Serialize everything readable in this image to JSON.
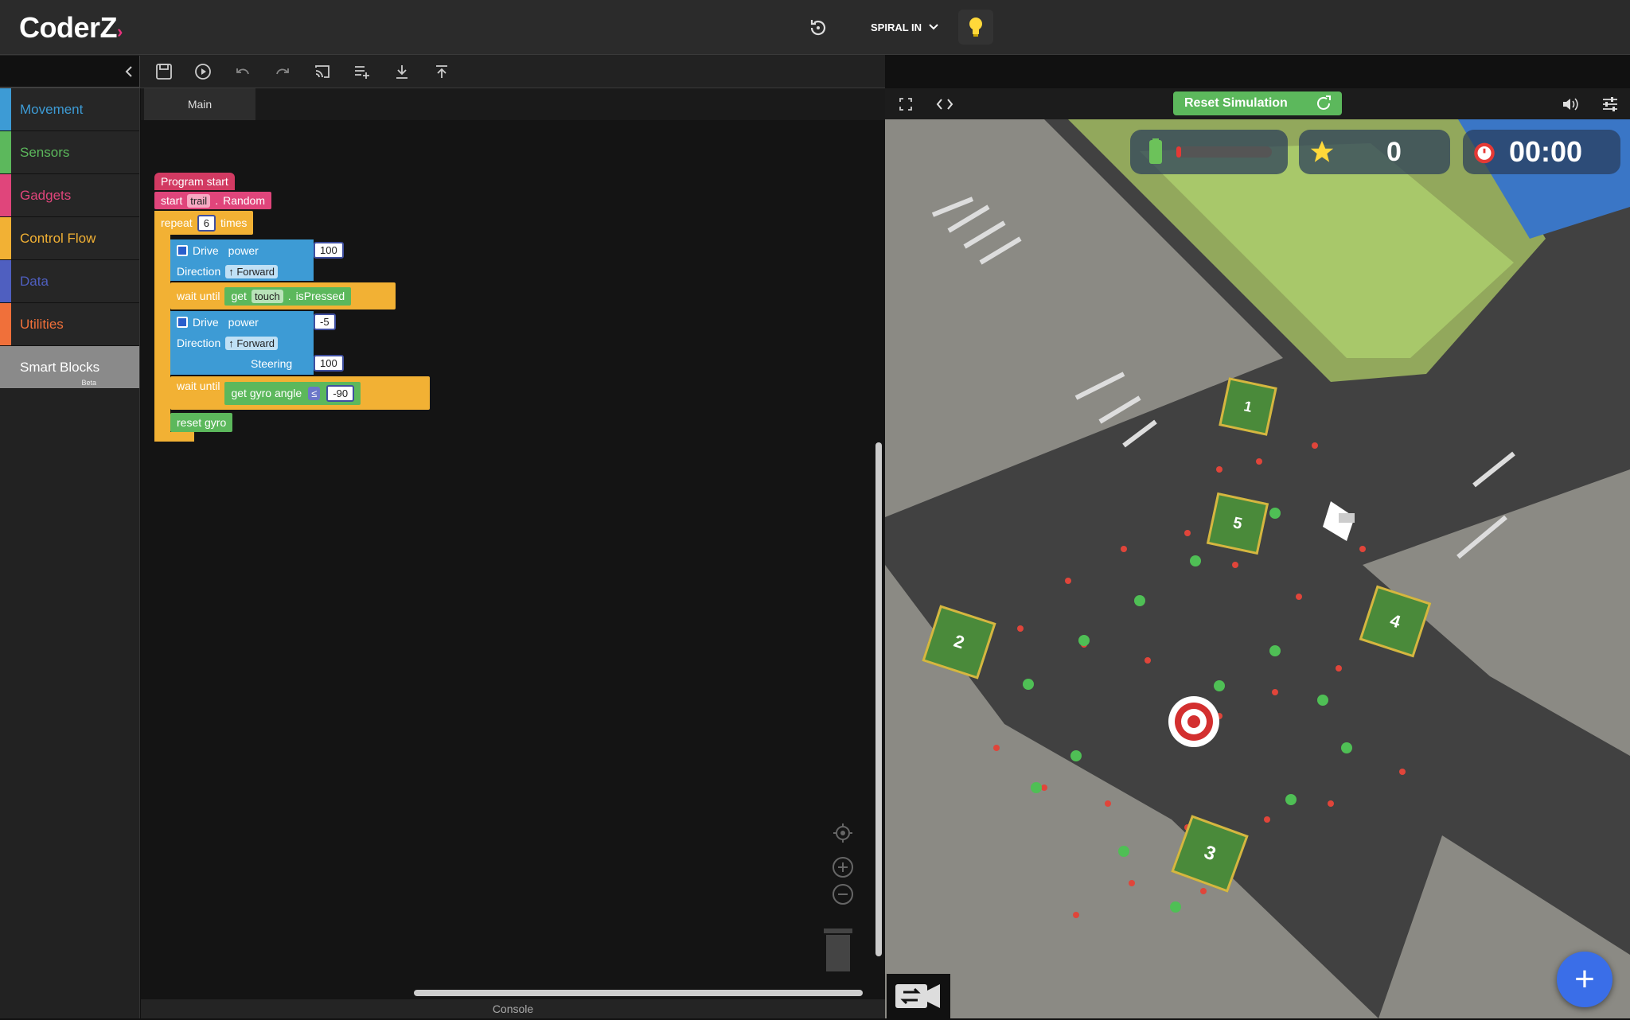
{
  "app": {
    "logo": "CoderZ",
    "mission": "SPIRAL IN"
  },
  "sidebar": {
    "categories": [
      {
        "label": "Movement",
        "color": "#3d9bd5"
      },
      {
        "label": "Sensors",
        "color": "#5cb85c"
      },
      {
        "label": "Gadgets",
        "color": "#e0457b"
      },
      {
        "label": "Control Flow",
        "color": "#f2b134"
      },
      {
        "label": "Data",
        "color": "#4f5fc0"
      },
      {
        "label": "Utilities",
        "color": "#f0703a"
      },
      {
        "label": "Smart Blocks",
        "color": "#8a8a8a",
        "badge": "Beta"
      }
    ]
  },
  "workspace": {
    "tab": "Main",
    "blocks": {
      "program_start": "Program start",
      "start": "start",
      "trail": "trail",
      "dot": ".",
      "random": "Random",
      "repeat": "repeat",
      "repeat_count": "6",
      "times": "times",
      "drive": "Drive",
      "power": "power",
      "power1": "100",
      "direction": "Direction",
      "forward": "↑ Forward",
      "wait_until": "wait until",
      "get": "get",
      "touch": "touch",
      "is_pressed": "isPressed",
      "power2": "-5",
      "steering": "Steering",
      "steering_val": "100",
      "get_gyro_angle": "get gyro angle",
      "op": "≤",
      "angle": "-90",
      "reset_gyro": "reset gyro"
    },
    "console": "Console"
  },
  "simulation": {
    "reset_label": "Reset Simulation",
    "score": "0",
    "timer": "00:00",
    "boxes": [
      "1",
      "5",
      "2",
      "4",
      "3"
    ]
  }
}
